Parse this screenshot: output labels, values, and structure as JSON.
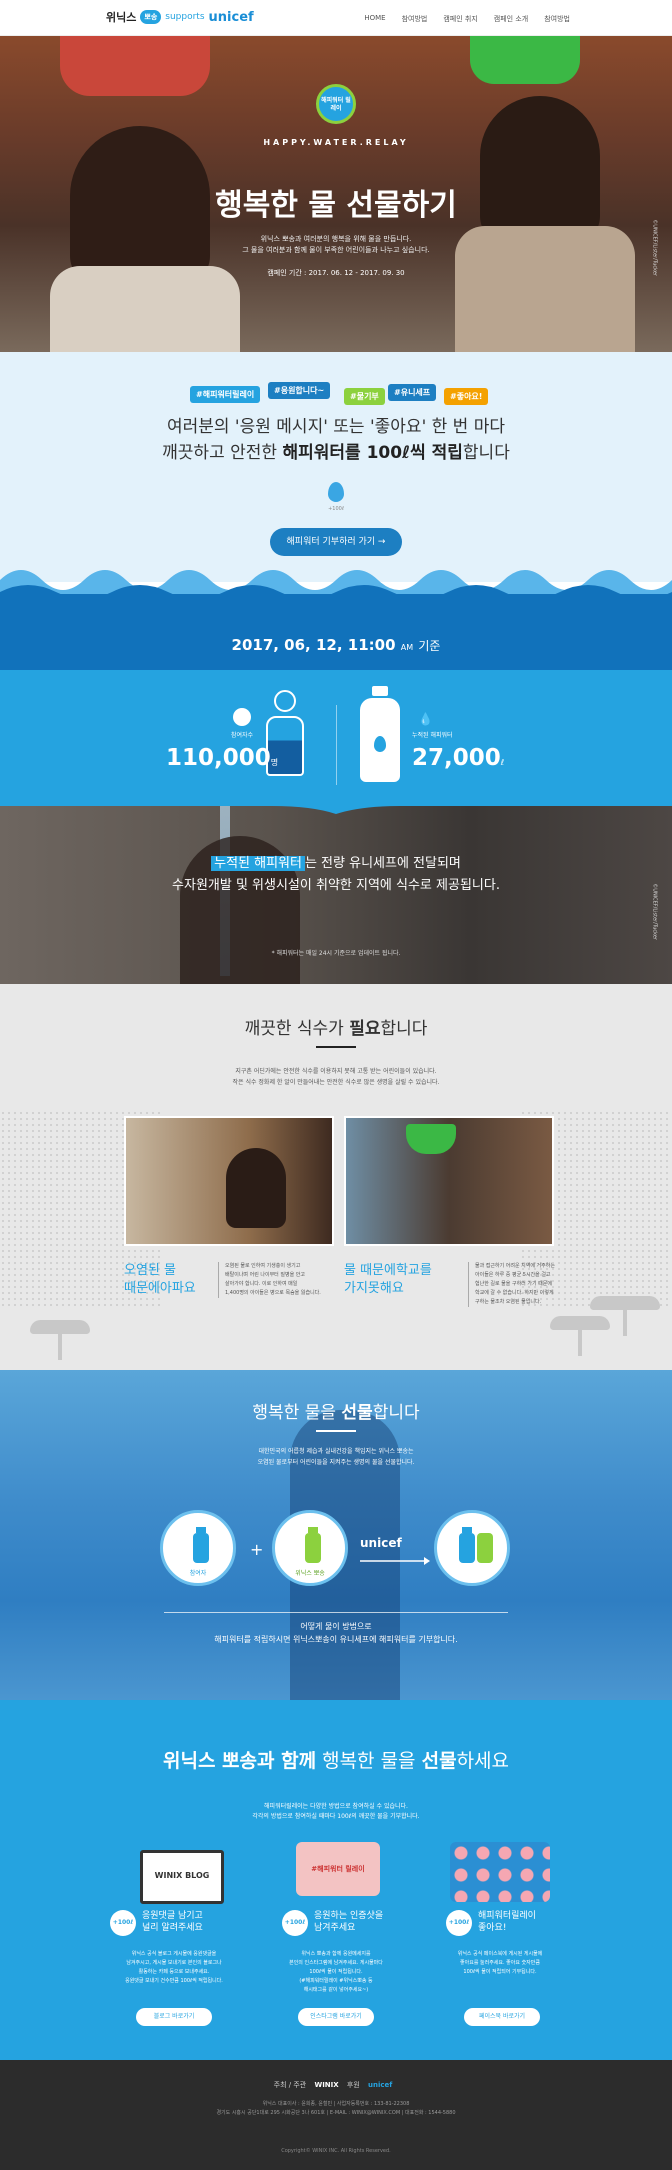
{
  "header": {
    "brand_wn": "위닉스",
    "brand_bubble": "뽀송",
    "brand_supports": "supports",
    "brand_unicef": "unicef",
    "nav": [
      "HOME",
      "참여방법",
      "캠페인 취지",
      "캠페인 소개",
      "참여방법"
    ]
  },
  "hero": {
    "badge": "해피워터 릴레이",
    "subtitle": "HAPPY.WATER.RELAY",
    "title": "행복한 물 선물하기",
    "desc_lines": [
      "위닉스 뽀송과 여러분의 행복을 위해 물을 만듭니다.",
      "그 물을 여러분과 함께 물이 부족한 어린이들과 나누고 싶습니다."
    ],
    "period": "캠페인 기간 : 2017. 06. 12 - 2017. 09. 30",
    "credit": "©UNICEF/Lister/Tucker"
  },
  "pledge": {
    "tags": [
      "#해피워터릴레이",
      "#응원합니다~",
      "#물기부",
      "#유니세프",
      "#좋아요!"
    ],
    "tag_colors": [
      "#25a3e0",
      "#1d7fc2",
      "#8cd13e",
      "#1d7fc2",
      "#f4a100"
    ],
    "line1": "여러분의 '응원 메시지' 또는 '좋아요' 한 번 마다",
    "line2_prefix": "깨끗하고 안전한 ",
    "line2_bold": "해피워터를 100ℓ씩 적립",
    "line2_suffix": "합니다",
    "drop_label": "+100ℓ",
    "cta": "해피워터 기부하러 가기 →"
  },
  "stats": {
    "date": "2017, 06, 12, 11:00",
    "date_am": "AM",
    "date_suffix": "기준",
    "participants_label": "참여자수",
    "participants_value": "110,000",
    "participants_unit": "명",
    "water_label": "누적된 해피워터",
    "water_value": "27,000",
    "water_unit": "ℓ"
  },
  "photo_band": {
    "highlight": "누적된 해피워터",
    "line1_suffix": "는 전량 유니세프에 전달되며",
    "line2": "수자원개발 및 위생시설이 취약한 지역에 식수로 제공됩니다.",
    "note": "* 해피워터는 매일 24시 기준으로 업데이트 됩니다.",
    "credit": "©UNICEF/Lister/Tucker"
  },
  "clean": {
    "title_prefix": "깨끗한 식수가 ",
    "title_bold": "필요",
    "title_suffix": "합니다",
    "desc_lines": [
      "지구촌 어딘가에는 안전한 식수를 이용하지 못해 고통 받는 어린이들이 있습니다.",
      "작은 식수 정화제 한 알이 만들어내는 안전한 식수로 많은 생명을 살릴 수 있습니다."
    ],
    "card_a_headline": [
      "오염된 물",
      "때문에아파요"
    ],
    "card_a_text": [
      "오염된 물로 인하여 기생충이 생기고",
      "배탈이나며 어린 나이부터 질병을 안고",
      "살아가야 합니다. 이로 인하여 매일",
      "1,400명의 아이들은 병으로 목숨을 잃습니다."
    ],
    "card_b_headline": [
      "물 때문에학교를",
      "가지못해요"
    ],
    "card_b_text": [
      "물과 접근하기 어려운 지역에 거주하는",
      "아이들은 하루 중 평균 5시간을 걸고",
      "험난한 길로 물을 구하러 가기 때문에",
      "학교에 갈 수 없습니다. 하지만 이렇게",
      "구하는 물조차 오염된 물입니다."
    ]
  },
  "gift": {
    "title_prefix": "행복한 물을 ",
    "title_bold": "선물",
    "title_suffix": "합니다",
    "desc_lines": [
      "대한민국의 어릅청 제습과 실내건강을 책임지는 위닉스 뽀송는",
      "오염된 물로부터 어린이들을 지켜주는 생명의 물을 선물합니다."
    ],
    "circle_a": "참여자",
    "circle_b": "위닉스 뽀송",
    "unicef": "unicef",
    "foot_lines": [
      "어떻게 물이 방법으로",
      "해피워터를 적립하시면 위닉스뽀송이 유니세프에 해피워터를 기부합니다."
    ]
  },
  "share": {
    "title_bold1": "위닉스 뽀송과 함께",
    "title_mid": " 행복한 물을 ",
    "title_bold2": "선물",
    "title_end": "하세요",
    "desc_lines": [
      "해피워터릴레이는 다양한 방법으로 참여하실 수 있습니다.",
      "각각의 방법으로 참여하실 때마다 100ℓ의 깨끗한 물을 기부합니다."
    ],
    "blog_illust": "WINIX BLOG",
    "insta_illust": "#해피워터 릴레이",
    "badge": "+100ℓ",
    "col1_head": [
      "응원댓글 남기고",
      "널리 알려주세요"
    ],
    "col1_text": [
      "위닉스 공식 블로그 게시물에 응원댓글을",
      "남겨주시고, 게시물 보내기로 본인의 블로그나",
      "활동하는 카페 등으로 보내주세요.",
      "응원댓글 보내기 건수만큼 100ℓ씩 적립됩니다."
    ],
    "col1_btn": "블로그 바로가기",
    "col2_head": [
      "응원하는 인증샷을",
      "남겨주세요"
    ],
    "col2_text": [
      "위닉스 뽀송과 함께 응원메세지를",
      "본인의 인스타그램에 남겨주세요. 게시물마다",
      "100ℓ씩 물이 적립됩니다.",
      "(#해피워터릴레이 #위닉스뽀송 등",
      "해시태그를 같이 넣어주세요~)"
    ],
    "col2_btn": "인스타그램 바로가기",
    "col3_head": [
      "해피워터릴레이",
      "좋아요!"
    ],
    "col3_text": [
      "위닉스 공식 페이스북에 게시된 게시물에",
      "좋아요를 눌러주세요. 좋아요 숫자만큼",
      "100ℓ씩 물이 적립되어 기부됩니다."
    ],
    "col3_btn": "페이스북 바로가기"
  },
  "footer": {
    "host": "주최 / 주관",
    "winix": "WINIX",
    "partner": "후원",
    "unicef": "unicef",
    "info_lines": [
      "위닉스 대표이사 : 윤희종, 윤철민 | 사업자등록번호 : 133-81-22308",
      "경기도 시흥시 공단1대로 295 시화공단 3나 601호 | E-MAIL : WINIX@WINIX.COM | 대표전화 : 1544-5880"
    ],
    "copy": "Copyright© WINIX INC. All Rights Reserved."
  }
}
